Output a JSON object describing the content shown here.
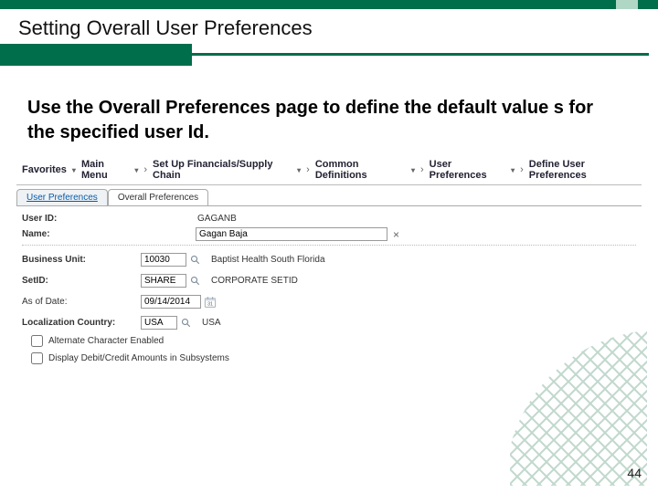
{
  "slide": {
    "title": "Setting Overall User Preferences",
    "body": "Use the Overall Preferences page to define the default value s for the specified user Id.",
    "page_number": "44"
  },
  "breadcrumb": {
    "items": [
      "Favorites",
      "Main Menu",
      "Set Up Financials/Supply Chain",
      "Common Definitions",
      "User Preferences",
      "Define User Preferences"
    ]
  },
  "tabs": {
    "inactive": "User Preferences",
    "active": "Overall Preferences"
  },
  "form": {
    "user_id_label": "User ID:",
    "user_id_value": "GAGANB",
    "name_label": "Name:",
    "name_value": "Gagan Baja",
    "bu_label": "Business Unit:",
    "bu_value": "10030",
    "bu_desc": "Baptist Health South Florida",
    "setid_label": "SetID:",
    "setid_value": "SHARE",
    "setid_desc": "CORPORATE SETID",
    "asof_label": "As of Date:",
    "asof_value": "09/14/2014",
    "loc_label": "Localization Country:",
    "loc_value": "USA",
    "loc_desc": "USA",
    "chk_alt": "Alternate Character Enabled",
    "chk_dc": "Display Debit/Credit Amounts in Subsystems"
  }
}
